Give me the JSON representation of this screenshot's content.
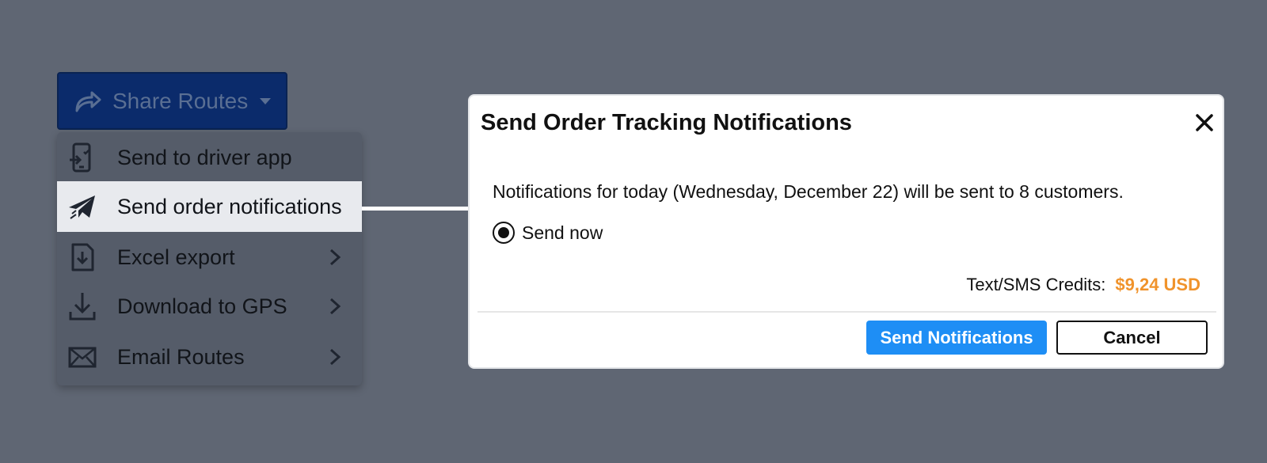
{
  "share_button": {
    "label": "Share Routes",
    "icon": "share-arrow-icon",
    "caret_icon": "caret-down-icon",
    "background": "#0b2b6b"
  },
  "menu": {
    "items": [
      {
        "label": "Send to driver app",
        "icon": "phone-send-icon",
        "submenu": false,
        "active": false
      },
      {
        "label": "Send order notifications",
        "icon": "paper-plane-icon",
        "submenu": false,
        "active": true
      },
      {
        "label": "Excel export",
        "icon": "file-download-icon",
        "submenu": true,
        "active": false
      },
      {
        "label": "Download to GPS",
        "icon": "download-icon",
        "submenu": true,
        "active": false
      },
      {
        "label": "Email Routes",
        "icon": "envelope-icon",
        "submenu": true,
        "active": false
      }
    ]
  },
  "dialog": {
    "title": "Send Order Tracking Notifications",
    "close_icon": "close-icon",
    "message": "Notifications for today (Wednesday, December 22) will be sent to 8 customers.",
    "radio_option": {
      "label": "Send now",
      "selected": true
    },
    "credits_label": "Text/SMS Credits:",
    "credits_value": "$9,24 USD",
    "credits_color": "#f0932b",
    "primary_button": "Send Notifications",
    "primary_color": "#1e8ef5",
    "cancel_button": "Cancel"
  }
}
